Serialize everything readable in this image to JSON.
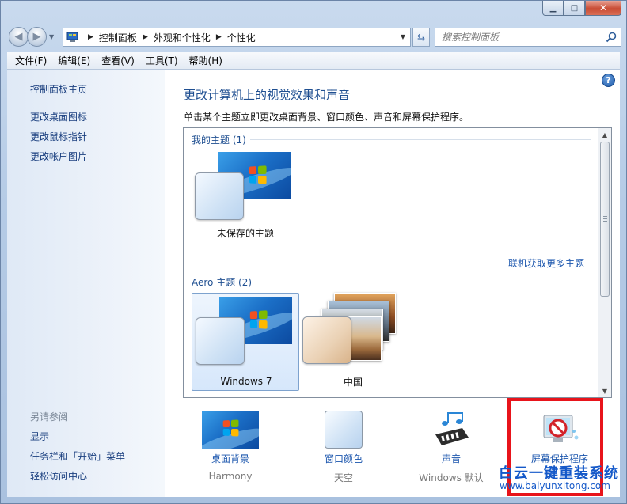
{
  "window": {
    "minimize_glyph": "▁",
    "maximize_glyph": "□",
    "close_glyph": "✕"
  },
  "nav": {
    "back_glyph": "◀",
    "forward_glyph": "▶",
    "breadcrumbs": [
      "控制面板",
      "外观和个性化",
      "个性化"
    ],
    "search_placeholder": "搜索控制面板"
  },
  "menu": [
    "文件(F)",
    "编辑(E)",
    "查看(V)",
    "工具(T)",
    "帮助(H)"
  ],
  "sidebar": {
    "links": [
      "控制面板主页",
      "更改桌面图标",
      "更改鼠标指针",
      "更改帐户图片"
    ],
    "see_also_heading": "另请参阅",
    "see_also": [
      "显示",
      "任务栏和「开始」菜单",
      "轻松访问中心"
    ]
  },
  "main": {
    "title": "更改计算机上的视觉效果和声音",
    "description": "单击某个主题立即更改桌面背景、窗口颜色、声音和屏幕保护程序。",
    "my_themes_heading": "我的主题 (1)",
    "unsaved_theme_label": "未保存的主题",
    "more_themes_link": "联机获取更多主题",
    "aero_heading": "Aero 主题 (2)",
    "aero_themes": [
      "Windows 7",
      "中国"
    ],
    "selected_theme": "Windows 7"
  },
  "bottom": [
    {
      "label": "桌面背景",
      "sub": "Harmony",
      "icon": "wallpaper-icon"
    },
    {
      "label": "窗口颜色",
      "sub": "天空",
      "icon": "window-color-icon"
    },
    {
      "label": "声音",
      "sub": "Windows 默认",
      "icon": "sound-icon"
    },
    {
      "label": "屏幕保护程序",
      "sub": "",
      "icon": "screensaver-icon"
    }
  ],
  "watermark": {
    "title": "白云一键重装系统",
    "url": "www.baiyunxitong.com"
  },
  "colors": {
    "link": "#1a55ad",
    "title": "#1f4f91",
    "highlight_box": "#e8141b",
    "watermark": "#1559c9"
  }
}
